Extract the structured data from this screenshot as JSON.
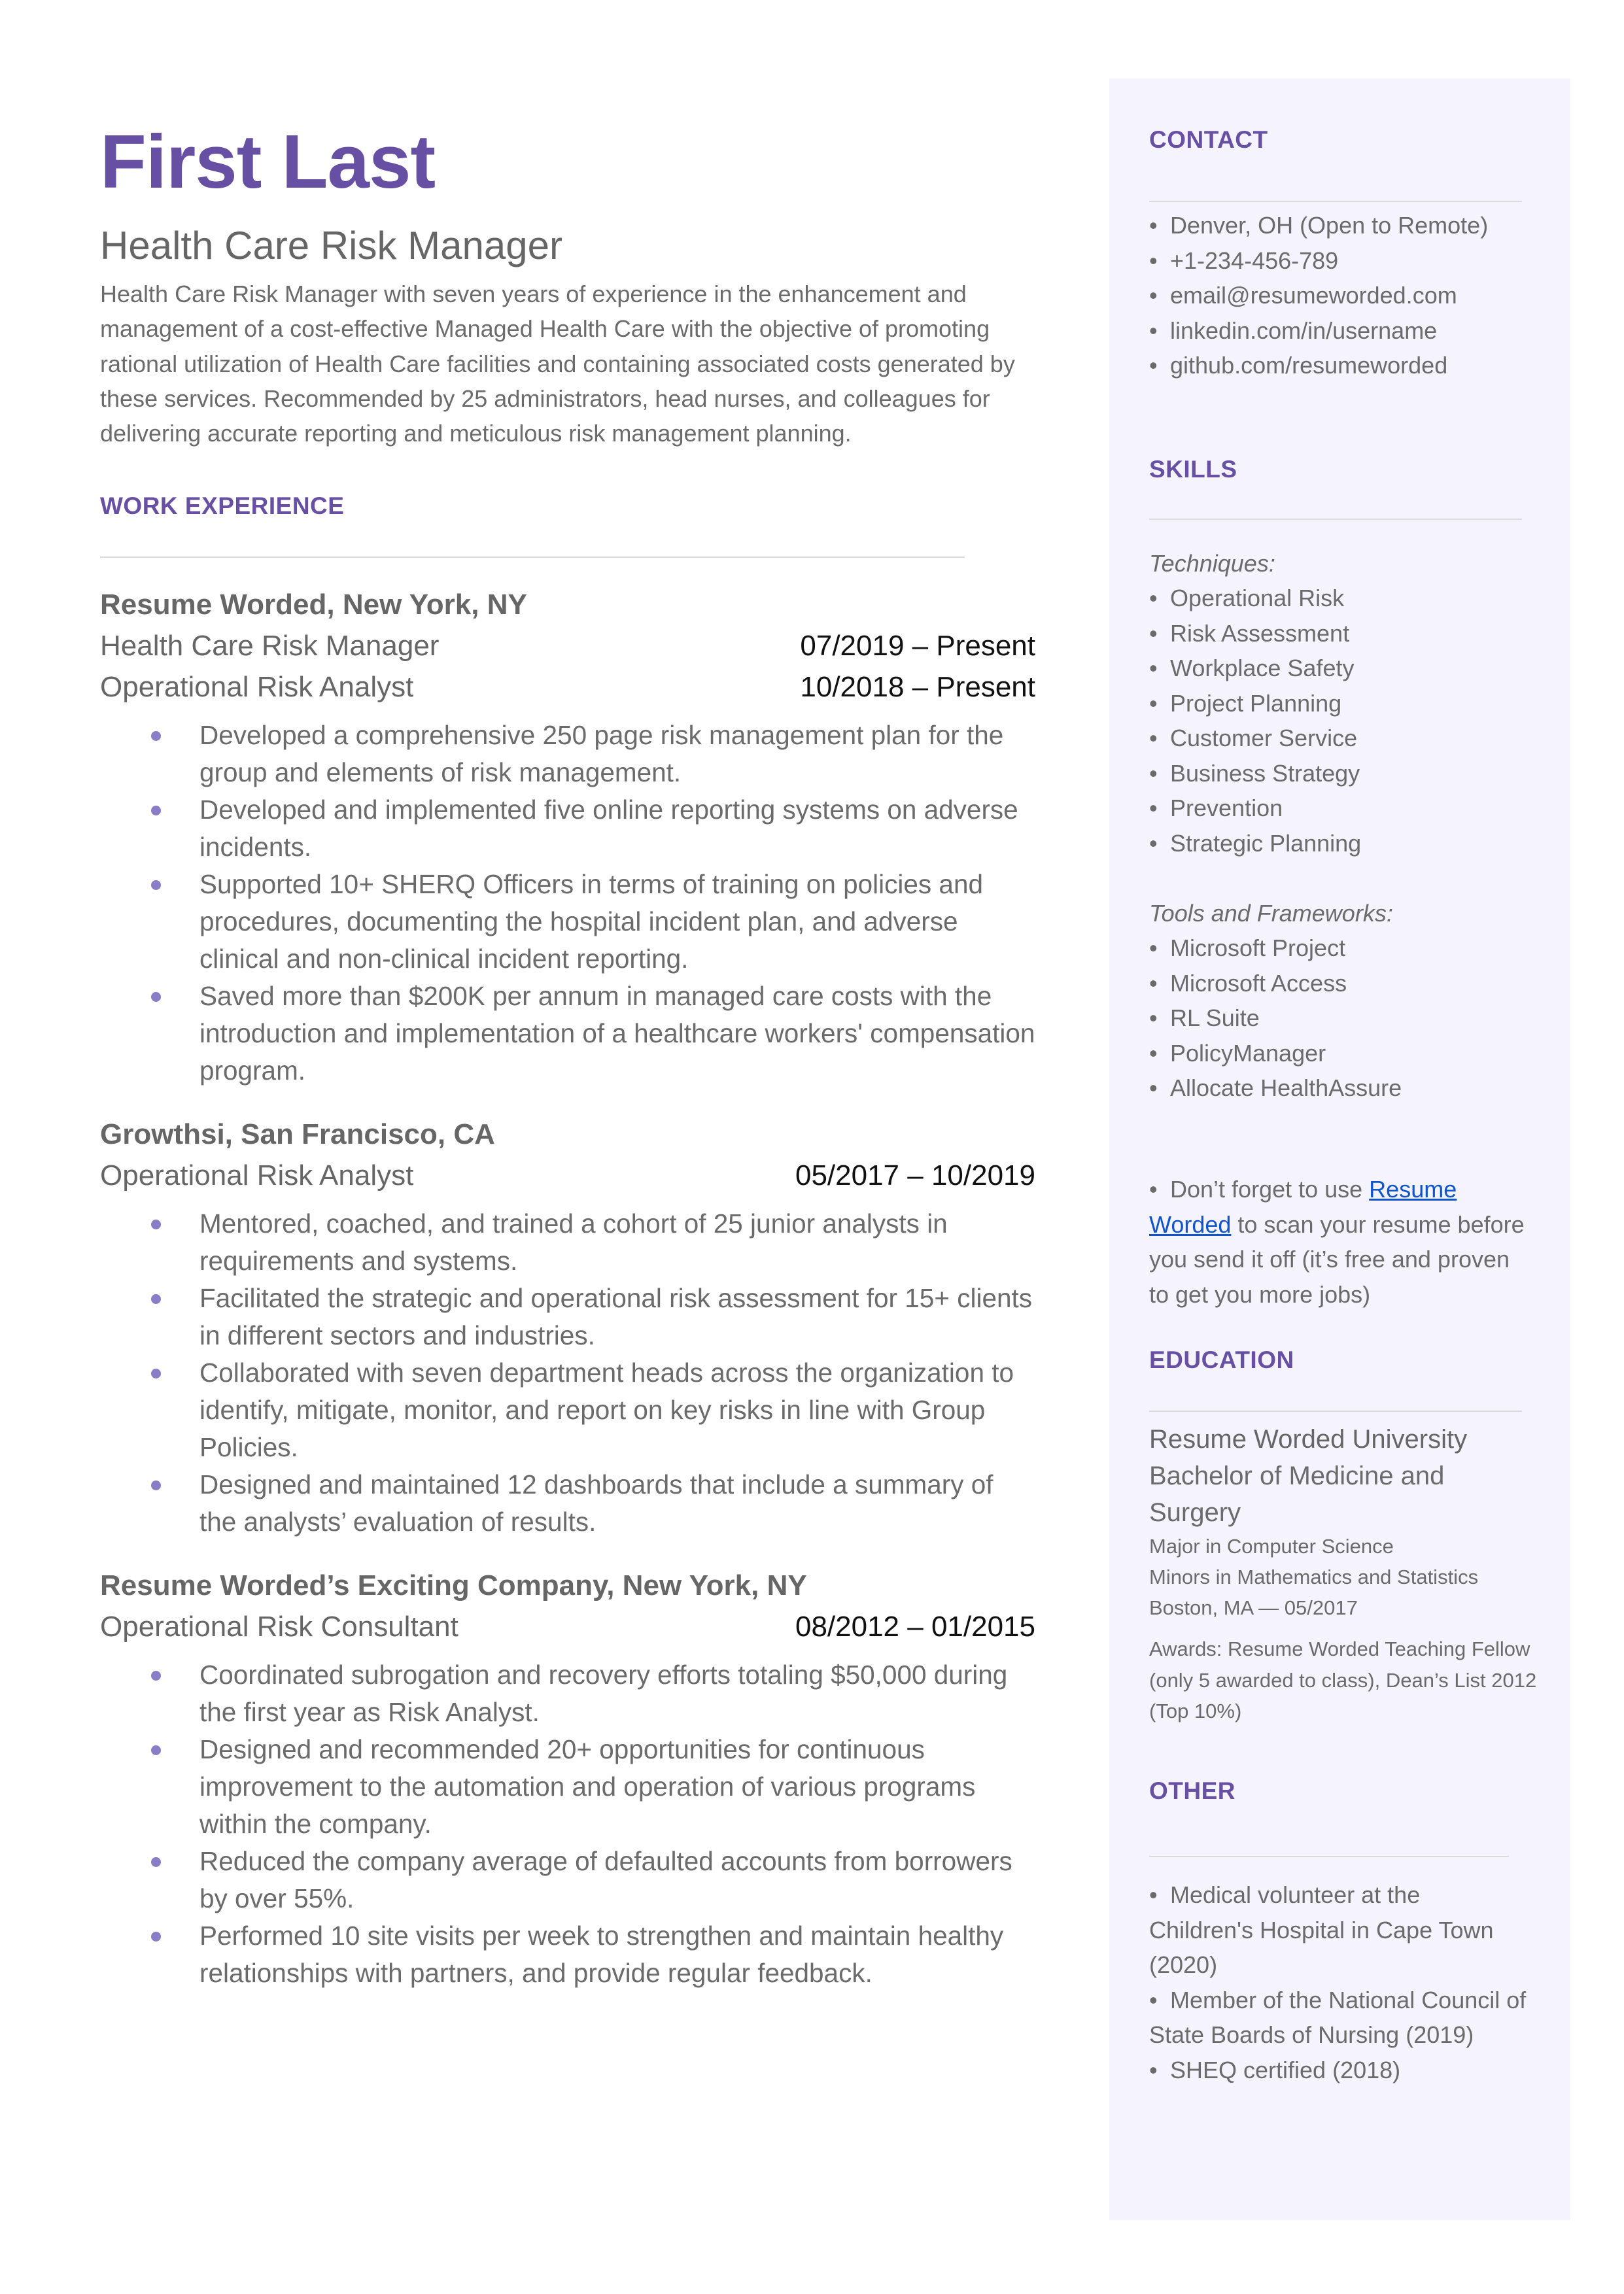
{
  "header": {
    "name": "First Last",
    "title": "Health Care Risk Manager",
    "summary": "Health Care Risk Manager with seven years of experience in the enhancement and management of a cost-effective Managed Health Care with the objective of promoting rational utilization of Health Care facilities and containing associated costs generated by these services. Recommended by 25 administrators, head nurses, and colleagues for delivering accurate reporting and meticulous risk management planning."
  },
  "colors": {
    "accent": "#6750a4",
    "bullet": "#8b7cc8",
    "sidebar_bg": "#f5f3fe",
    "link": "#1155cc"
  },
  "work": {
    "heading": "WORK EXPERIENCE",
    "jobs": [
      {
        "company": "Resume Worded, New York, NY",
        "roles": [
          {
            "title": "Health Care Risk Manager",
            "dates": "07/2019 – Present"
          },
          {
            "title": "Operational Risk Analyst",
            "dates": "10/2018 – Present"
          }
        ],
        "bullets": [
          "Developed a comprehensive 250 page risk management plan for the group and elements of risk management.",
          "Developed and implemented five online reporting systems on adverse incidents.",
          "Supported 10+ SHERQ Officers in terms of training on policies and procedures, documenting the hospital incident plan, and adverse clinical and non-clinical incident reporting.",
          "Saved more than $200K per annum in managed care costs with the introduction and implementation of a healthcare workers' compensation program."
        ]
      },
      {
        "company": "Growthsi, San Francisco, CA",
        "roles": [
          {
            "title": "Operational Risk Analyst",
            "dates": "05/2017 – 10/2019"
          }
        ],
        "bullets": [
          "Mentored, coached, and trained a cohort of 25 junior analysts in requirements and systems.",
          "Facilitated the strategic and operational risk assessment for 15+ clients in different sectors and industries.",
          "Collaborated with seven department heads across the organization to identify, mitigate, monitor, and report on key risks in line with Group Policies.",
          "Designed and maintained 12 dashboards that include a summary of the analysts’ evaluation of results."
        ]
      },
      {
        "company": "Resume Worded’s Exciting Company, New York, NY",
        "roles": [
          {
            "title": "Operational Risk Consultant",
            "dates": "08/2012 – 01/2015"
          }
        ],
        "bullets": [
          "Coordinated subrogation and recovery efforts totaling $50,000 during the first year as Risk Analyst.",
          "Designed and recommended 20+ opportunities for continuous improvement to the automation and operation of various programs within the company.",
          "Reduced the company average of defaulted accounts from borrowers by over 55%.",
          "Performed 10 site visits per week to strengthen and maintain healthy relationships with partners, and provide regular feedback."
        ]
      }
    ]
  },
  "sidebar": {
    "contact": {
      "heading": "CONTACT",
      "items": [
        "Denver, OH (Open to Remote)",
        "+1-234-456-789",
        "email@resumeworded.com",
        "linkedin.com/in/username",
        "github.com/resumeworded"
      ]
    },
    "skills": {
      "heading": "SKILLS",
      "techniques_label": "Techniques:",
      "techniques": [
        "Operational Risk",
        "Risk Assessment",
        "Workplace Safety",
        "Project Planning",
        "Customer Service",
        "Business Strategy",
        "Prevention",
        "Strategic Planning"
      ],
      "tools_label": "Tools and Frameworks:",
      "tools": [
        "Microsoft Project",
        "Microsoft Access",
        "RL Suite",
        "PolicyManager",
        "Allocate HealthAssure"
      ],
      "note_prefix": "Don’t forget to use ",
      "note_link": "Resume Worded",
      "note_suffix": " to scan your resume before you send it off (it’s free and proven to get you more jobs)"
    },
    "education": {
      "heading": "EDUCATION",
      "school": "Resume Worded University",
      "degree": "Bachelor of Medicine and Surgery",
      "major": "Major in Computer Science",
      "minors": "Minors in Mathematics and Statistics",
      "location_date": "Boston, MA — 05/2017",
      "awards": "Awards: Resume Worded Teaching Fellow (only 5 awarded to class), Dean’s List 2012 (Top 10%)"
    },
    "other": {
      "heading": "OTHER",
      "items": [
        "Medical volunteer at the Children's Hospital in Cape Town (2020)",
        "Member of the National Council of State Boards of Nursing (2019)",
        "SHEQ certified (2018)"
      ]
    }
  }
}
